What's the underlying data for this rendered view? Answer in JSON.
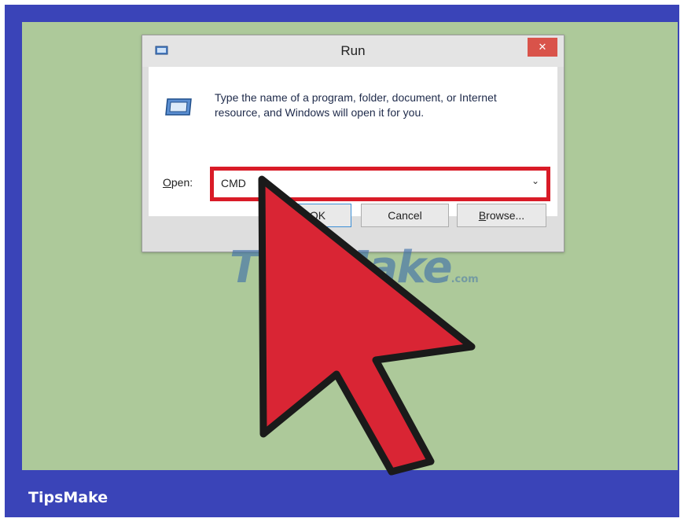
{
  "footer": {
    "brand": "TipsMake"
  },
  "dialog": {
    "title": "Run",
    "close_icon": "close-icon",
    "description": "Type the name of a program, folder, document, or Internet resource, and Windows will open it for you.",
    "open_label_prefix": "O",
    "open_label_rest": "pen:",
    "input_value": "CMD",
    "ok_label": "OK",
    "cancel_label": "Cancel",
    "browse_prefix": "B",
    "browse_rest": "rowse..."
  },
  "watermark": {
    "text": "TipsMake",
    "suffix": ".com"
  },
  "colors": {
    "frame": "#3a44b8",
    "panel": "#adc99a",
    "highlight": "#d91b27",
    "arrow": "#d92534",
    "close": "#d9534a"
  },
  "icons": {
    "title": "run-icon",
    "dropdown": "chevron-down-icon",
    "pointer": "cursor-arrow-icon"
  }
}
